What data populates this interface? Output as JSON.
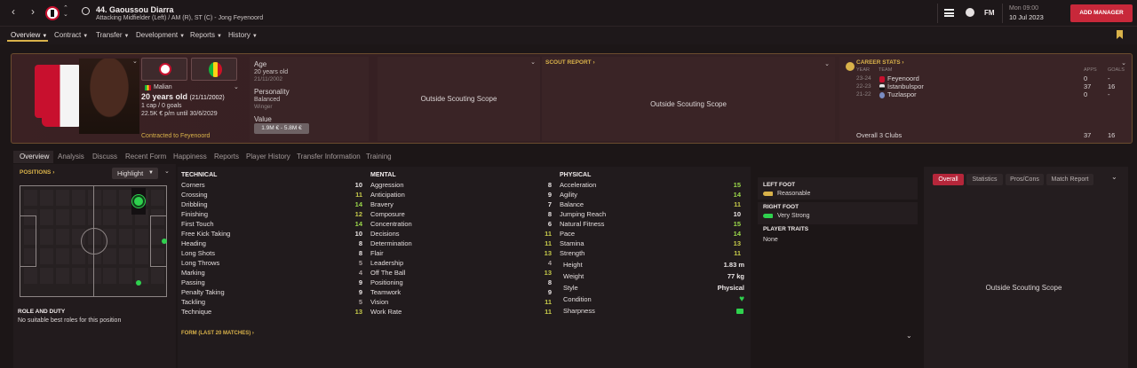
{
  "player": {
    "number_name": "44. Gaoussou Diarra",
    "positions": "Attacking Midfielder (Left) / AM (R), ST (C) - Jong Feyenoord"
  },
  "datetime": {
    "time": "Mon 09:00",
    "date": "10 Jul 2023"
  },
  "add_manager": "ADD MANAGER",
  "fm_label": "FM",
  "nav": [
    {
      "label": "Overview"
    },
    {
      "label": "Contract"
    },
    {
      "label": "Transfer"
    },
    {
      "label": "Development"
    },
    {
      "label": "Reports"
    },
    {
      "label": "History"
    }
  ],
  "profile": {
    "nationality": "Malian",
    "age_line": "20 years old",
    "dob_paren": "(21/11/2002)",
    "caps": "1 cap / 0 goals",
    "wage": "22.5K € p/m until 30/6/2029",
    "contract_club": "Contracted to Feyenoord"
  },
  "bio": {
    "age_h": "Age",
    "age": "20 years old",
    "dob": "21/11/2002",
    "personality_h": "Personality",
    "personality": "Balanced",
    "role": "Winger",
    "value_h": "Value",
    "value": "1.9M € - 5.8M €"
  },
  "scout": {
    "scope1": "Outside Scouting Scope",
    "report_h": "SCOUT REPORT ›",
    "scope2": "Outside Scouting Scope"
  },
  "career": {
    "title": "CAREER STATS ›",
    "h_year": "YEAR",
    "h_team": "TEAM",
    "h_apps": "APPS",
    "h_goals": "GOALS",
    "rows": [
      {
        "year": "23-24",
        "team": "Feyenoord",
        "apps": "0",
        "goals": "-"
      },
      {
        "year": "22-23",
        "team": "İstanbulspor",
        "apps": "37",
        "goals": "16"
      },
      {
        "year": "21-22",
        "team": "Tuzlaspor",
        "apps": "0",
        "goals": "-"
      }
    ],
    "overall": "Overall 3 Clubs",
    "overall_apps": "37",
    "overall_goals": "16"
  },
  "subtabs": [
    "Overview",
    "Analysis",
    "Discuss",
    "Recent Form",
    "Happiness",
    "Reports",
    "Player History",
    "Transfer Information",
    "Training"
  ],
  "positions_title": "POSITIONS ›",
  "highlight": "Highlight",
  "role_duty": {
    "title": "ROLE AND DUTY",
    "text": "No suitable best roles for this position"
  },
  "technical": {
    "title": "TECHNICAL",
    "rows": [
      [
        "Corners",
        "10",
        "w"
      ],
      [
        "Crossing",
        "11",
        "y"
      ],
      [
        "Dribbling",
        "14",
        "g"
      ],
      [
        "Finishing",
        "12",
        "y"
      ],
      [
        "First Touch",
        "14",
        "g"
      ],
      [
        "Free Kick Taking",
        "10",
        "w"
      ],
      [
        "Heading",
        "8",
        "w"
      ],
      [
        "Long Shots",
        "8",
        "w"
      ],
      [
        "Long Throws",
        "5",
        "gr"
      ],
      [
        "Marking",
        "4",
        "gr"
      ],
      [
        "Passing",
        "9",
        "w"
      ],
      [
        "Penalty Taking",
        "9",
        "w"
      ],
      [
        "Tackling",
        "5",
        "gr"
      ],
      [
        "Technique",
        "13",
        "y"
      ]
    ]
  },
  "mental": {
    "title": "MENTAL",
    "rows": [
      [
        "Aggression",
        "8",
        "w"
      ],
      [
        "Anticipation",
        "9",
        "w"
      ],
      [
        "Bravery",
        "7",
        "w"
      ],
      [
        "Composure",
        "8",
        "w"
      ],
      [
        "Concentration",
        "6",
        "w"
      ],
      [
        "Decisions",
        "11",
        "y"
      ],
      [
        "Determination",
        "11",
        "y"
      ],
      [
        "Flair",
        "13",
        "y"
      ],
      [
        "Leadership",
        "4",
        "gr"
      ],
      [
        "Off The Ball",
        "13",
        "y"
      ],
      [
        "Positioning",
        "8",
        "w"
      ],
      [
        "Teamwork",
        "9",
        "w"
      ],
      [
        "Vision",
        "11",
        "y"
      ],
      [
        "Work Rate",
        "11",
        "y"
      ]
    ]
  },
  "physical": {
    "title": "PHYSICAL",
    "rows": [
      [
        "Acceleration",
        "15",
        "g"
      ],
      [
        "Agility",
        "14",
        "g"
      ],
      [
        "Balance",
        "11",
        "y"
      ],
      [
        "Jumping Reach",
        "10",
        "w"
      ],
      [
        "Natural Fitness",
        "15",
        "g"
      ],
      [
        "Pace",
        "14",
        "g"
      ],
      [
        "Stamina",
        "13",
        "y"
      ],
      [
        "Strength",
        "11",
        "y"
      ]
    ],
    "height_l": "Height",
    "height": "1.83 m",
    "weight_l": "Weight",
    "weight": "77 kg",
    "style_l": "Style",
    "style": "Physical",
    "condition_l": "Condition",
    "sharpness_l": "Sharpness"
  },
  "form_title": "FORM (LAST 20 MATCHES) ›",
  "feet": {
    "left_h": "LEFT FOOT",
    "left": "Reasonable",
    "right_h": "RIGHT FOOT",
    "right": "Very Strong",
    "traits_h": "PLAYER TRAITS",
    "traits": "None"
  },
  "overall_tabs": [
    "Overall",
    "Statistics",
    "Pros/Cons",
    "Match Report"
  ],
  "overall_scope": "Outside Scouting Scope",
  "colors": {
    "accent": "#c8283a",
    "gold": "#d9b24a",
    "green": "#2fd14e"
  }
}
